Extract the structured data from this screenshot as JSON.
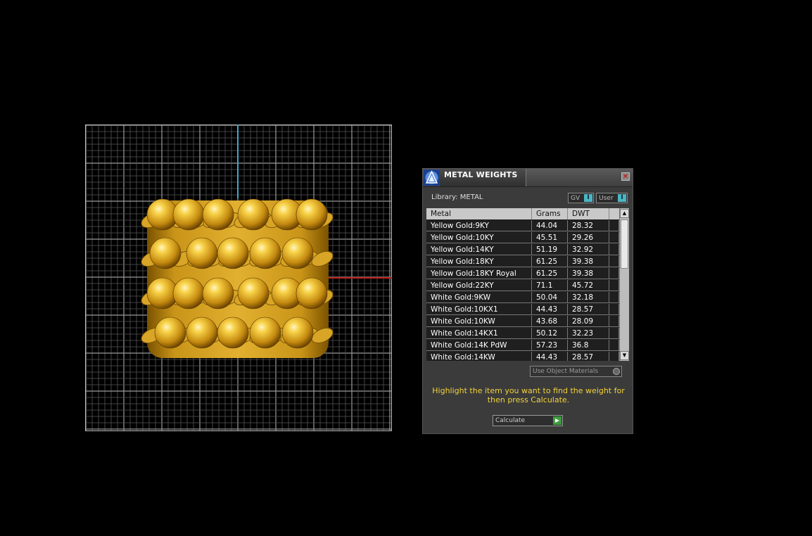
{
  "panel": {
    "title": "METAL WEIGHTS",
    "close_symbol": "✕",
    "library_label": "Library: METAL",
    "gv_label": "GV",
    "user_label": "User",
    "toggle_glyph": "I",
    "columns": [
      "Metal",
      "Grams",
      "DWT"
    ],
    "rows": [
      {
        "metal": "Yellow Gold:9KY",
        "grams": "44.04",
        "dwt": "28.32"
      },
      {
        "metal": "Yellow Gold:10KY",
        "grams": "45.51",
        "dwt": "29.26"
      },
      {
        "metal": "Yellow Gold:14KY",
        "grams": "51.19",
        "dwt": "32.92"
      },
      {
        "metal": "Yellow Gold:18KY",
        "grams": "61.25",
        "dwt": "39.38"
      },
      {
        "metal": "Yellow Gold:18KY Royal",
        "grams": "61.25",
        "dwt": "39.38"
      },
      {
        "metal": "Yellow Gold:22KY",
        "grams": "71.1",
        "dwt": "45.72"
      },
      {
        "metal": "White Gold:9KW",
        "grams": "50.04",
        "dwt": "32.18"
      },
      {
        "metal": "White Gold:10KX1",
        "grams": "44.43",
        "dwt": "28.57"
      },
      {
        "metal": "White Gold:10KW",
        "grams": "43.68",
        "dwt": "28.09"
      },
      {
        "metal": "White Gold:14KX1",
        "grams": "50.12",
        "dwt": "32.23"
      },
      {
        "metal": "White Gold:14K PdW",
        "grams": "57.23",
        "dwt": "36.8"
      },
      {
        "metal": "White Gold:14KW",
        "grams": "44.43",
        "dwt": "28.57"
      }
    ],
    "scroll_up_glyph": "▲",
    "scroll_down_glyph": "▼",
    "use_object_materials": "Use Object Materials",
    "instructions": "Highlight the item you want to find the weight for then press Calculate.",
    "calculate_label": "Calculate",
    "calculate_glyph": "▶"
  },
  "viewport": {
    "icons": [
      "grid",
      "y-axis",
      "x-axis",
      "gold-ring-model"
    ],
    "colors": {
      "grid": "#808080",
      "y_axis": "#3fa7c9",
      "x_axis": "#c0201b",
      "gold": "#e0a820"
    }
  },
  "colors": {
    "panel_bg": "#3b3b3b",
    "header_bg": "#c9c9c9",
    "instruction_text": "#f2d23a",
    "toggle_accent": "#4ab6c4",
    "calc_accent": "#3c9a3c"
  }
}
